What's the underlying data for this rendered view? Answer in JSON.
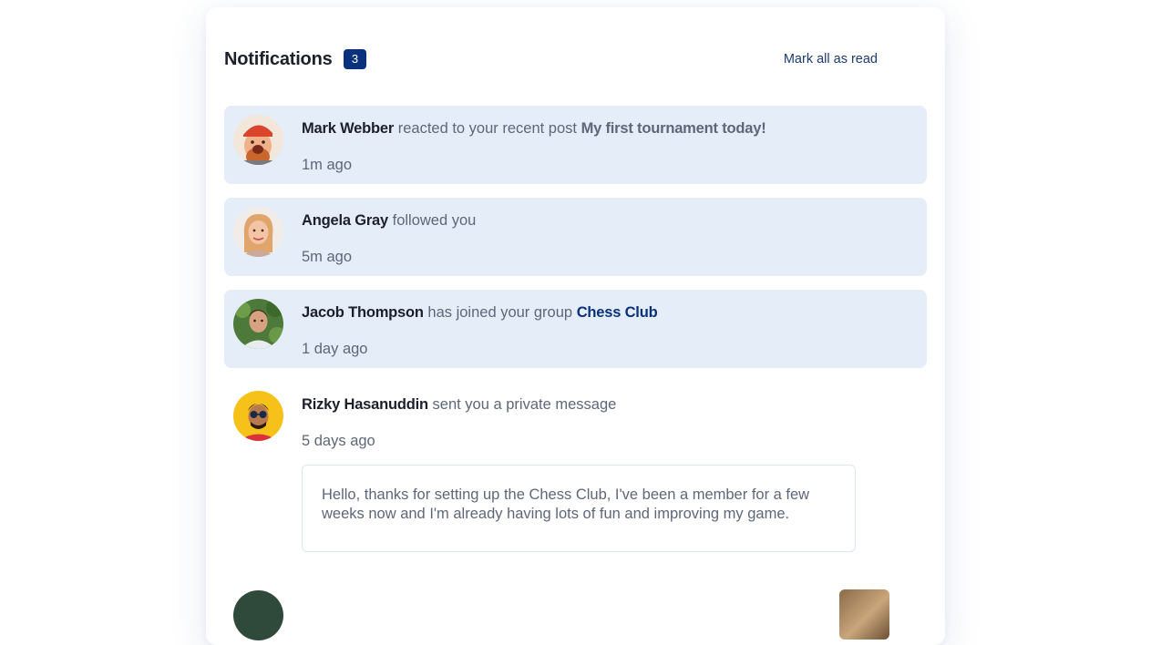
{
  "header": {
    "title": "Notifications",
    "unread_count": "3",
    "mark_all_label": "Mark all as read"
  },
  "notifications": [
    {
      "name": "Mark Webber",
      "action": "reacted to your recent post",
      "target": "My first tournament today!",
      "time": "1m ago",
      "unread": true,
      "avatar_icon": "avatar-mark-webber"
    },
    {
      "name": "Angela Gray",
      "action": "followed you",
      "time": "5m ago",
      "unread": true,
      "avatar_icon": "avatar-angela-gray"
    },
    {
      "name": "Jacob Thompson",
      "action": "has joined your group",
      "target": "Chess Club",
      "time": "1 day ago",
      "unread": true,
      "avatar_icon": "avatar-jacob-thompson"
    },
    {
      "name": "Rizky Hasanuddin",
      "action": "sent you a private message",
      "time": "5 days ago",
      "unread": false,
      "message": "Hello, thanks for setting up the Chess Club, I've been a member for a few weeks now and I'm already having lots of fun and improving my game.",
      "avatar_icon": "avatar-rizky-hasanuddin"
    }
  ],
  "colors": {
    "unread_bg": "#e4edf8",
    "badge_bg": "#0a317b",
    "heading": "#1c202b",
    "text": "#5e6778",
    "link": "#0a317b"
  }
}
